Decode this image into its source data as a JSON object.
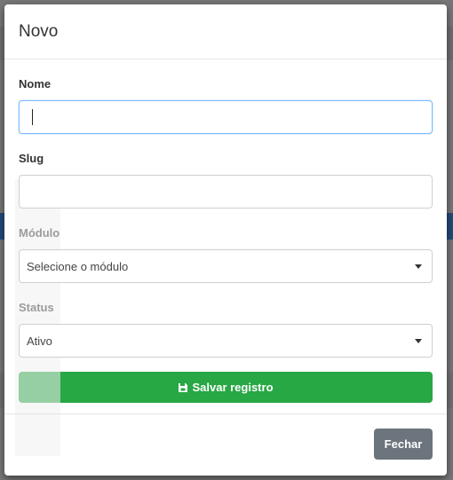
{
  "modal": {
    "title": "Novo",
    "fields": {
      "nome": {
        "label": "Nome",
        "value": ""
      },
      "slug": {
        "label": "Slug",
        "value": ""
      },
      "modulo": {
        "label": "Módulo",
        "selected": "Selecione o módulo"
      },
      "status": {
        "label": "Status",
        "selected": "Ativo"
      }
    },
    "save_label": "Salvar registro",
    "close_label": "Fechar"
  },
  "colors": {
    "save": "#28a745",
    "close": "#6c757d",
    "focus": "#80bdff"
  },
  "icons": {
    "save": "floppy-disk-icon",
    "dropdown": "caret-down-icon"
  }
}
